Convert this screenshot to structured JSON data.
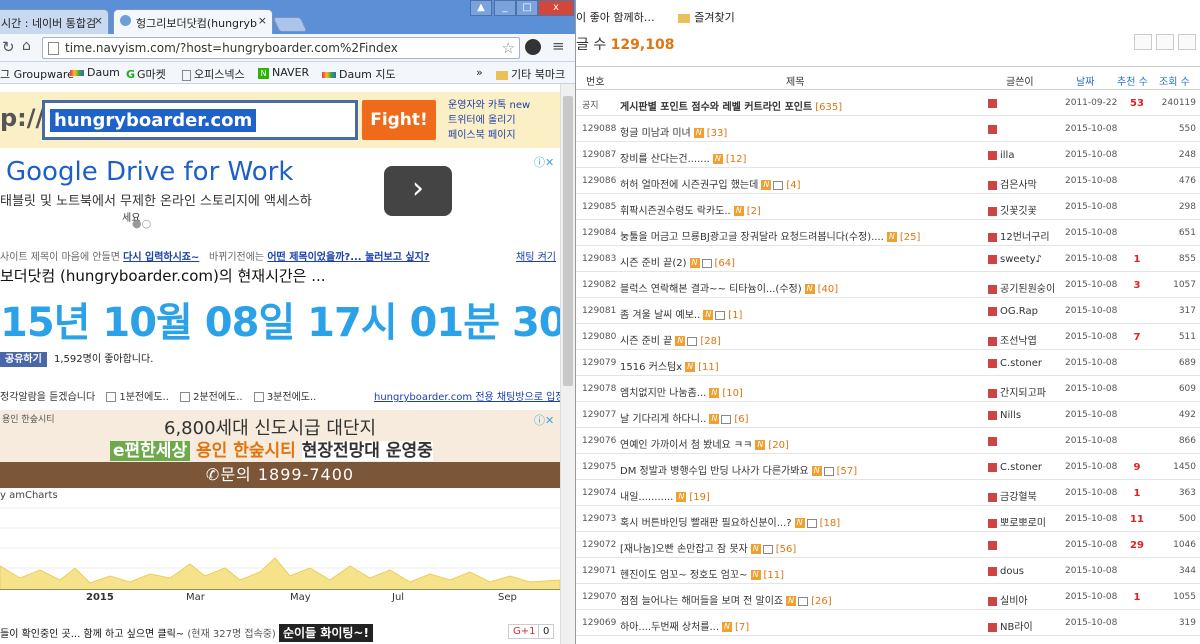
{
  "browser": {
    "tabs": [
      {
        "label": "시간 : 네이버 통합검",
        "active": false
      },
      {
        "label": "헝그리보더닷컴(hungryb",
        "active": true
      }
    ],
    "url": "time.navyism.com/?host=hungryboarder.com%2Findex",
    "bookmarks": [
      "그 Groupware",
      "Daum",
      "G마켓",
      "오피스넥스",
      "NAVER",
      "Daum 지도",
      "기타 북마크"
    ],
    "window_controls": [
      "▲",
      "_",
      "□",
      "x"
    ]
  },
  "time_page": {
    "logo_fragment": "p://",
    "search_value": "hungryboarder.com",
    "fight_label": "Fight!",
    "side_links": [
      "운영자와 카톡 new",
      "트위터에 올리기",
      "페이스북 페이지"
    ],
    "ad_title": "Google Drive for Work",
    "ad_sub": "태블릿 및 노트북에서 무제한 온라인 스토리지에 액세스하",
    "ad_sub2": "세요",
    "hint": "사이트 제목이 마음에 안들면",
    "hint_link": "다시 입력하시죠~",
    "hint_mid": "바뀌기전에는",
    "hint_link2": "어떤 제목이었을까?... 눌러보고 싶지?",
    "hint_right": "채팅 켜기",
    "title_line": "보더닷컴 (hungryboarder.com)의 현재시간은 ...",
    "time_value": "15년 10월 08일 17시 01분 30초",
    "share_btn": "공유하기",
    "share_text": "1,592명이 좋아합니다.",
    "alarm_label": "정각알람을 듣겠습니다",
    "alarm_opts": [
      "1분전에도..",
      "2분전에도..",
      "3분전에도.."
    ],
    "alarm_right": "hungryboarder.com 전용 채팅방으로 입장",
    "ad2_brand": "용인 한숲시티",
    "ad2_l1": "6,800세대 신도시급 대단지",
    "ad2_l2a": "e편한세상",
    "ad2_l2b": "용인 한숲시티",
    "ad2_l2c": "현장전망대 운영중",
    "ad2_l3": "✆문의  1899-7400",
    "chart_credit": "y amCharts",
    "axis_labels": [
      "2015",
      "Mar",
      "May",
      "Jul",
      "Sep"
    ],
    "bottom_text": "들이 확인중인 곳... 함께 하고 싶으면 클릭~",
    "bottom_count": "(현재 327명 접속중)",
    "bottom_hl": "순이들 화이팅~!",
    "gplus": "G+1",
    "gcount": "0"
  },
  "board": {
    "bm_left": "이 좋아 함께하…",
    "bm_fav": "즐겨찾기",
    "count_label": "글 수",
    "count_value": "129,108",
    "headers": {
      "num": "번호",
      "title": "제목",
      "author": "글쓴이",
      "date": "날짜",
      "rec": "추천 수",
      "views": "조회 수"
    },
    "rows": [
      {
        "num": "공지",
        "title": "게시판별 포인트 점수와 레벨 커트라인 포인트",
        "cm": "[635]",
        "author": "",
        "date": "2011-09-22",
        "rec": "53",
        "views": "240119",
        "badge": false,
        "file": false
      },
      {
        "num": "129088",
        "title": "헝글 미남과 미녀",
        "cm": "[33]",
        "author": "",
        "date": "2015-10-08",
        "rec": "",
        "views": "550",
        "badge": true,
        "file": false
      },
      {
        "num": "129087",
        "title": "장비를 산다는건.......",
        "cm": "[12]",
        "author": "illa",
        "date": "2015-10-08",
        "rec": "",
        "views": "248",
        "badge": true,
        "file": false
      },
      {
        "num": "129086",
        "title": "허허 얼마전에 시즌권구입 했는데",
        "cm": "[4]",
        "author": "검은사막",
        "date": "2015-10-08",
        "rec": "",
        "views": "476",
        "badge": true,
        "file": true
      },
      {
        "num": "129085",
        "title": "휘팍시즌권수령도 락카도..",
        "cm": "[2]",
        "author": "깃꽃깃꽃",
        "date": "2015-10-08",
        "rec": "",
        "views": "298",
        "badge": true,
        "file": false
      },
      {
        "num": "129084",
        "title": "눙툴을 머금고 므룡BJ광고글 장궈달라 요청드려봅니다(수정)....",
        "cm": "[25]",
        "author": "12번너구리",
        "date": "2015-10-08",
        "rec": "",
        "views": "651",
        "badge": true,
        "file": false
      },
      {
        "num": "129083",
        "title": "시즌 준비 끝(2)",
        "cm": "[64]",
        "author": "sweety♪",
        "date": "2015-10-08",
        "rec": "1",
        "views": "855",
        "badge": true,
        "file": true
      },
      {
        "num": "129082",
        "title": "블럭스 연락해본 결과~~ 티타늄이...(수정)",
        "cm": "[40]",
        "author": "공기된원숭이",
        "date": "2015-10-08",
        "rec": "3",
        "views": "1057",
        "badge": true,
        "file": false
      },
      {
        "num": "129081",
        "title": "좀 겨울 날씨 예보..",
        "cm": "[1]",
        "author": "OG.Rap",
        "date": "2015-10-08",
        "rec": "",
        "views": "317",
        "badge": true,
        "file": true
      },
      {
        "num": "129080",
        "title": "시즌 준비 끝",
        "cm": "[28]",
        "author": "조선낙엽",
        "date": "2015-10-08",
        "rec": "7",
        "views": "511",
        "badge": true,
        "file": true
      },
      {
        "num": "129079",
        "title": "1516 커스텀x",
        "cm": "[11]",
        "author": "C.stoner",
        "date": "2015-10-08",
        "rec": "",
        "views": "689",
        "badge": true,
        "file": false
      },
      {
        "num": "129078",
        "title": "엠치없지만 나눔좀...",
        "cm": "[10]",
        "author": "간지되고파",
        "date": "2015-10-08",
        "rec": "",
        "views": "609",
        "badge": true,
        "file": false
      },
      {
        "num": "129077",
        "title": "날 기다리게 하다니..",
        "cm": "[6]",
        "author": "Nills",
        "date": "2015-10-08",
        "rec": "",
        "views": "492",
        "badge": true,
        "file": true
      },
      {
        "num": "129076",
        "title": "연예인 가까이서 첨 봤네요 ㅋㅋ",
        "cm": "[20]",
        "author": "",
        "date": "2015-10-08",
        "rec": "",
        "views": "866",
        "badge": true,
        "file": false
      },
      {
        "num": "129075",
        "title": "DM 정발과 병행수입 반딩 나사가 다른가봐요",
        "cm": "[57]",
        "author": "C.stoner",
        "date": "2015-10-08",
        "rec": "9",
        "views": "1450",
        "badge": true,
        "file": true
      },
      {
        "num": "129074",
        "title": "내일...........",
        "cm": "[19]",
        "author": "금강혈북",
        "date": "2015-10-08",
        "rec": "1",
        "views": "363",
        "badge": true,
        "file": false
      },
      {
        "num": "129073",
        "title": "혹시 버튼바인딩 빨래판 필요하신분이...?",
        "cm": "[18]",
        "author": "뽀로뽀로미",
        "date": "2015-10-08",
        "rec": "11",
        "views": "500",
        "badge": true,
        "file": true
      },
      {
        "num": "129072",
        "title": "[재나눔]오빤 손만잡고 잠 못자",
        "cm": "[56]",
        "author": "",
        "date": "2015-10-08",
        "rec": "29",
        "views": "1046",
        "badge": true,
        "file": true
      },
      {
        "num": "129071",
        "title": "헨진이도 엄꼬~ 정호도 엄꼬~",
        "cm": "[11]",
        "author": "dous",
        "date": "2015-10-08",
        "rec": "",
        "views": "344",
        "badge": true,
        "file": false
      },
      {
        "num": "129070",
        "title": "점점 늘어나는 해머들을 보며 전 말이죠",
        "cm": "[26]",
        "author": "실비아",
        "date": "2015-10-08",
        "rec": "1",
        "views": "1055",
        "badge": true,
        "file": true
      },
      {
        "num": "129069",
        "title": "하아....두번째 상처를...",
        "cm": "[7]",
        "author": "NB라이",
        "date": "2015-10-08",
        "rec": "",
        "views": "319",
        "badge": true,
        "file": false
      }
    ]
  }
}
